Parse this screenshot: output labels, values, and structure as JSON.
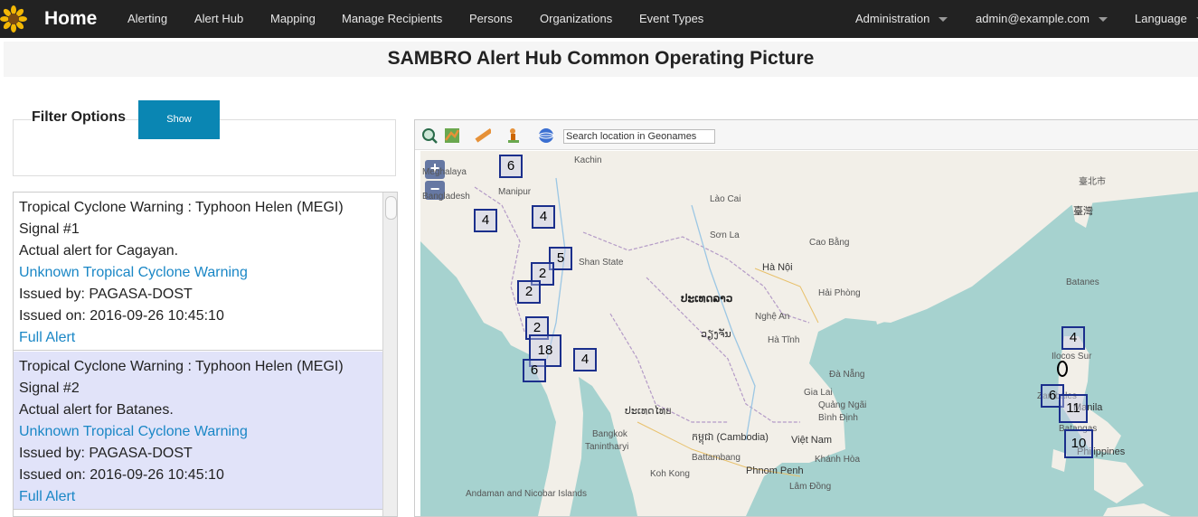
{
  "navbar": {
    "brand": "Home",
    "items": [
      "Alerting",
      "Alert Hub",
      "Mapping",
      "Manage Recipients",
      "Persons",
      "Organizations",
      "Event Types"
    ],
    "right": {
      "admin": "Administration",
      "user": "admin@example.com",
      "language": "Language"
    }
  },
  "page_title": "SAMBRO Alert Hub Common Operating Picture",
  "filter": {
    "title": "Filter Options",
    "show_label": "Show"
  },
  "alerts": [
    {
      "title": "Tropical Cyclone Warning : Typhoon Helen (MEGI) Signal #1",
      "summary": "Actual alert for Cagayan.",
      "type": "Unknown Tropical Cyclone Warning",
      "issued_by": "Issued by: PAGASA-DOST",
      "issued_on": "Issued on: 2016-09-26 10:45:10",
      "full_link": "Full Alert"
    },
    {
      "title": "Tropical Cyclone Warning : Typhoon Helen (MEGI) Signal #2",
      "summary": "Actual alert for Batanes.",
      "type": "Unknown Tropical Cyclone Warning",
      "issued_by": "Issued by: PAGASA-DOST",
      "issued_on": "Issued on: 2016-09-26 10:45:10",
      "full_link": "Full Alert"
    }
  ],
  "map": {
    "search_placeholder": "Search location in Geonames",
    "zoom_in": "+",
    "zoom_out": "−",
    "clusters": [
      "6",
      "4",
      "4",
      "5",
      "2",
      "2",
      "2",
      "18",
      "6",
      "4",
      "4",
      "6",
      "11",
      "10"
    ],
    "labels": [
      "Kachin",
      "Shan State",
      "Hà Nội",
      "ປະເທດລາວ",
      "ວຽງຈັນ",
      "ປະເທດໄທย",
      "កម្ពុជា (Cambodia)",
      "Việt Nam",
      "Phnom Penh",
      "Bangkok",
      "Manila",
      "Philippines",
      "臺灣",
      "臺北市",
      "Batanes",
      "Ilocos Sur",
      "Zambales",
      "Batangas",
      "Andaman and Nicobar Islands",
      "Bangladesh",
      "Meghalaya",
      "Manipur",
      "Battambang",
      "Hải Phòng",
      "Quảng Ngãi",
      "Bình Định",
      "Khánh Hòa",
      "Đà Nẵng",
      "Lâm Đồng",
      "Tanintharyi",
      "Koh Kong",
      "Sơn La",
      "Lào Cai",
      "Cao Bằng",
      "Nghệ An",
      "Hà Tĩnh",
      "Gia Lai"
    ]
  }
}
